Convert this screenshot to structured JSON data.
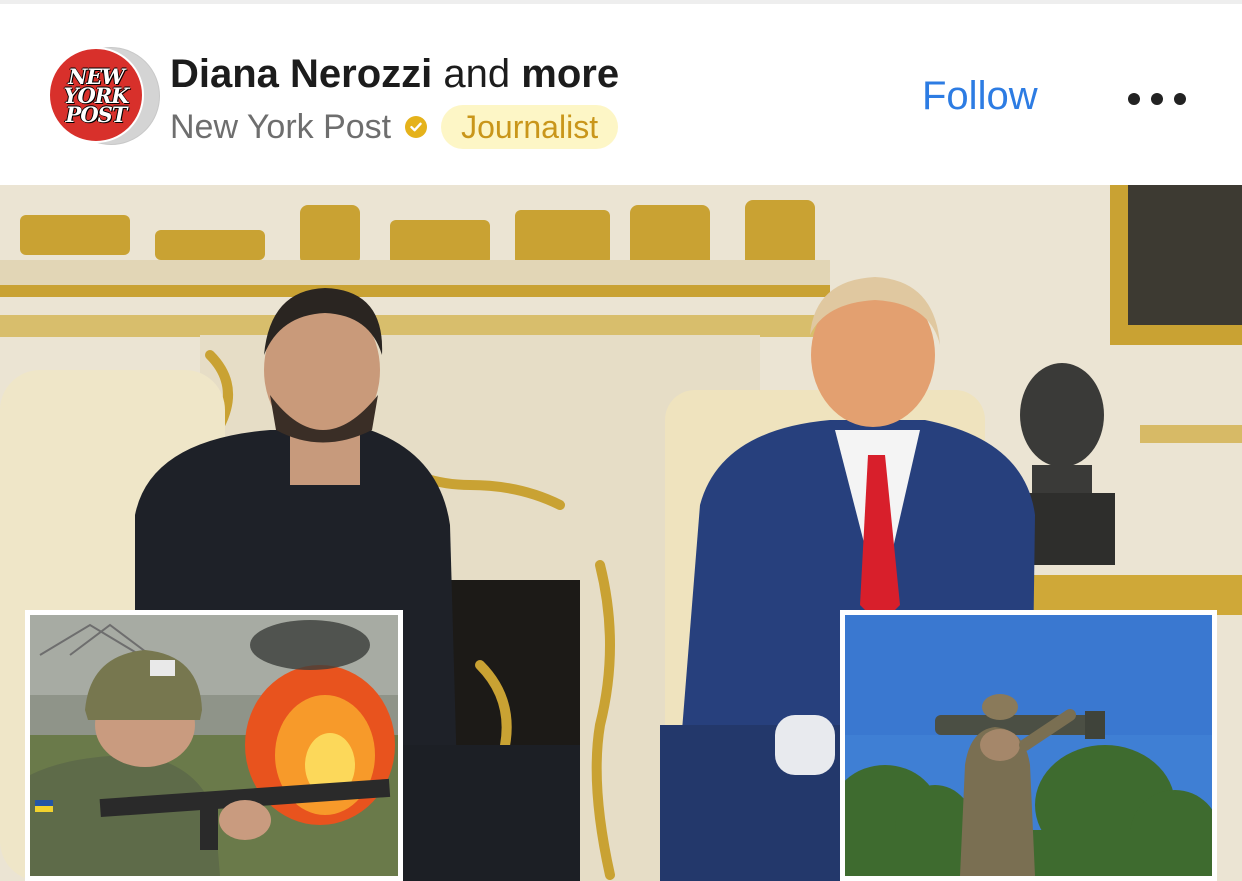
{
  "post": {
    "author_name": "Diana Nerozzi",
    "and_text": "and",
    "more_text": "more",
    "source": "New York Post",
    "badge": "Journalist",
    "follow_label": "Follow",
    "logo_lines": [
      "NEW",
      "YORK",
      "POST"
    ]
  },
  "colors": {
    "follow_blue": "#2d7ce3",
    "badge_bg": "#fdf6c6",
    "badge_text": "#c9961a",
    "verified_gold": "#e5b21b",
    "logo_red": "#d8302b"
  },
  "icons": {
    "more": "more-horizontal-icon",
    "verified": "verified-check-icon"
  }
}
